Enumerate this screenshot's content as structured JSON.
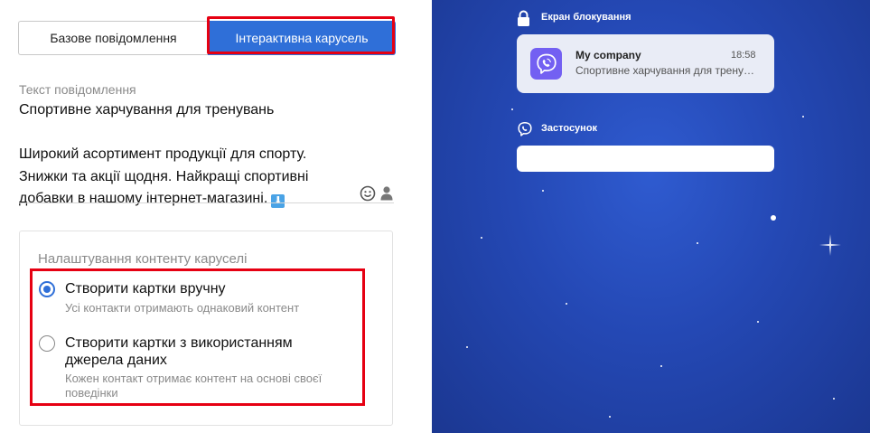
{
  "tabs": {
    "basic_label": "Базове повідомлення",
    "carousel_label": "Інтерактивна карусель",
    "active": "carousel"
  },
  "message": {
    "label": "Текст повідомлення",
    "text": "Спортивне харчування для тренувань\n\nШирокий асортимент продукції для спорту.\nЗнижки та акції щодня. Найкращі спортивні\nдобавки в нашому інтернет-магазині.",
    "emoji": "arrow-down-emoji"
  },
  "carousel_settings": {
    "title": "Налаштування контенту каруселі",
    "options": [
      {
        "title": "Створити картки вручну",
        "subtitle": "Усі контакти отримають однаковий контент",
        "checked": true
      },
      {
        "title": "Створити картки з використанням джерела даних",
        "subtitle": "Кожен контакт отримає контент на основі своєї поведінки",
        "checked": false
      }
    ]
  },
  "preview": {
    "lock_screen_label": "Екран блокування",
    "notification": {
      "sender": "My company",
      "time": "18:58",
      "preview_text": "Спортивне харчування для тренувань"
    },
    "app_label": "Застосунок"
  },
  "colors": {
    "accent": "#2f6fd8",
    "highlight": "#e60012",
    "viber": "#7360f2",
    "preview_bg": "#2448b4"
  }
}
